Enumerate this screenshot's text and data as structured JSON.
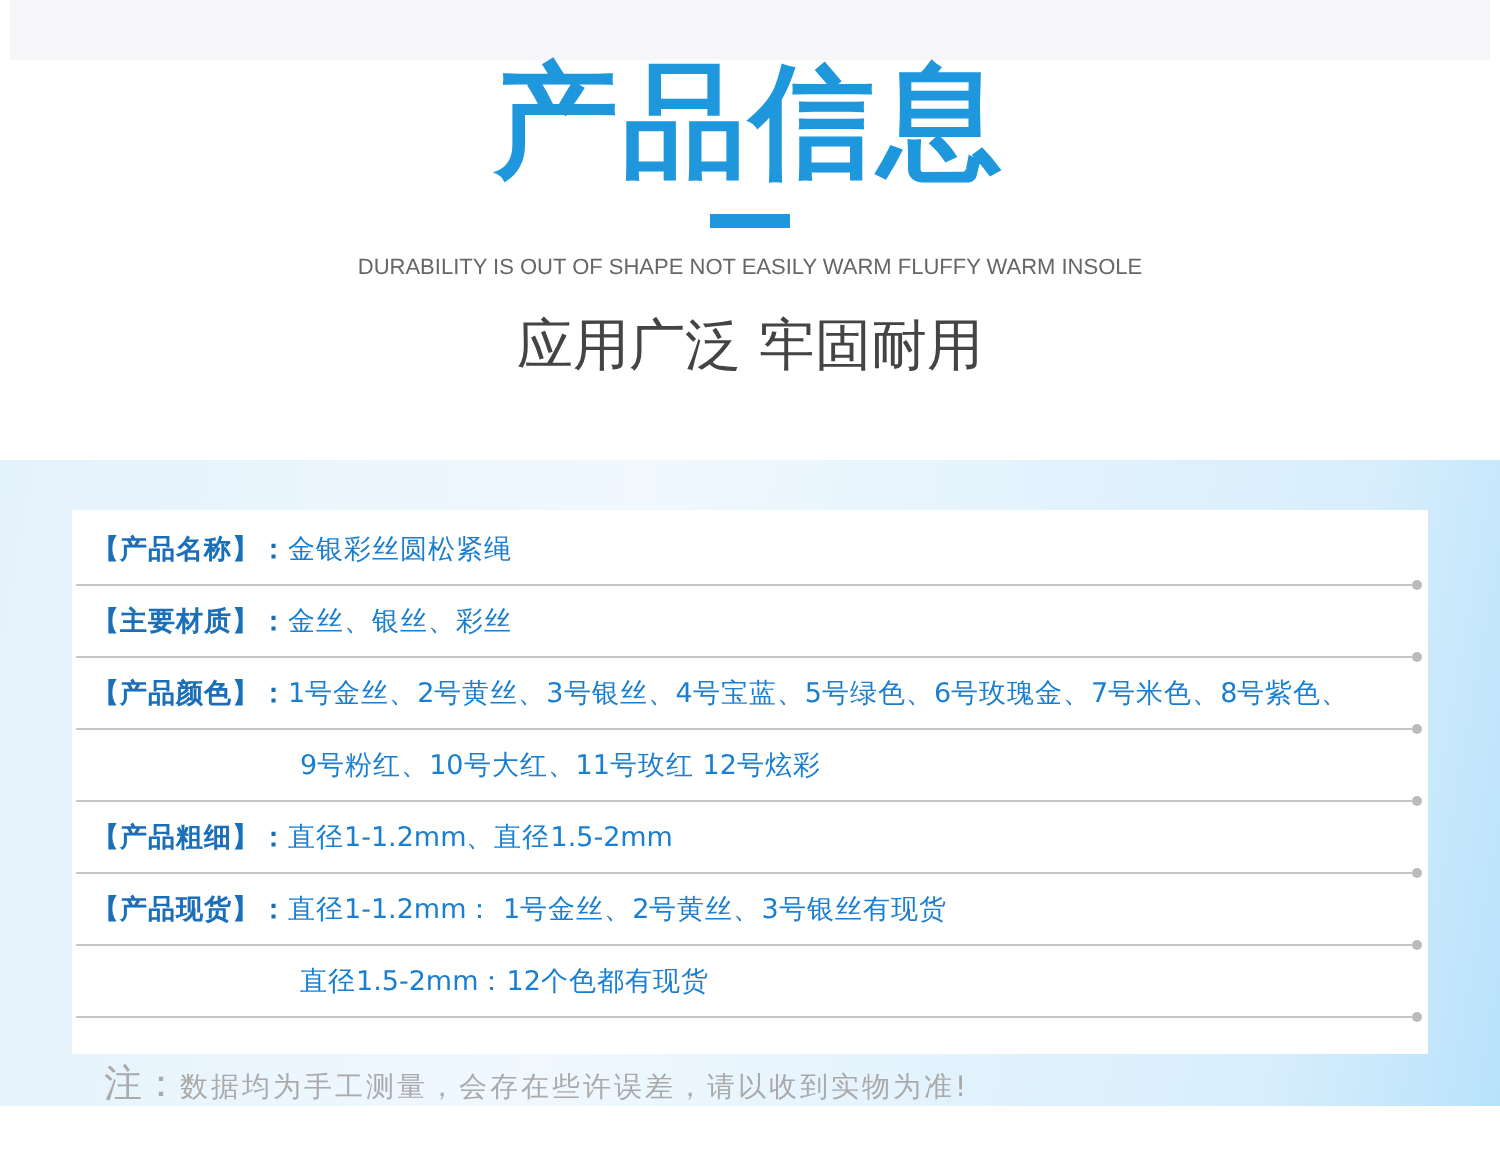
{
  "header": {
    "title": "产品信息",
    "english": "DURABILITY IS OUT OF SHAPE NOT EASILY WARM FLUFFY WARM INSOLE",
    "subtitle": "应用广泛 牢固耐用"
  },
  "rows": [
    {
      "label": "【产品名称】：",
      "value": "金银彩丝圆松紧绳"
    },
    {
      "label": "【主要材质】：",
      "value": "金丝、银丝、彩丝"
    },
    {
      "label": "【产品颜色】：",
      "value": "1号金丝、2号黄丝、3号银丝、4号宝蓝、5号绿色、6号玫瑰金、7号米色、8号紫色、"
    },
    {
      "value": "9号粉红、10号大红、11号玫红  12号炫彩"
    },
    {
      "label": "【产品粗细】：",
      "value": "直径1-1.2mm、直径1.5-2mm"
    },
    {
      "label": "【产品现货】：",
      "value": "直径1-1.2mm： 1号金丝、2号黄丝、3号银丝有现货"
    },
    {
      "value": "直径1.5-2mm：12个色都有现货"
    }
  ],
  "note": {
    "mark": "注：",
    "text": "数据均为手工测量，会存在些许误差，请以收到实物为准!"
  }
}
